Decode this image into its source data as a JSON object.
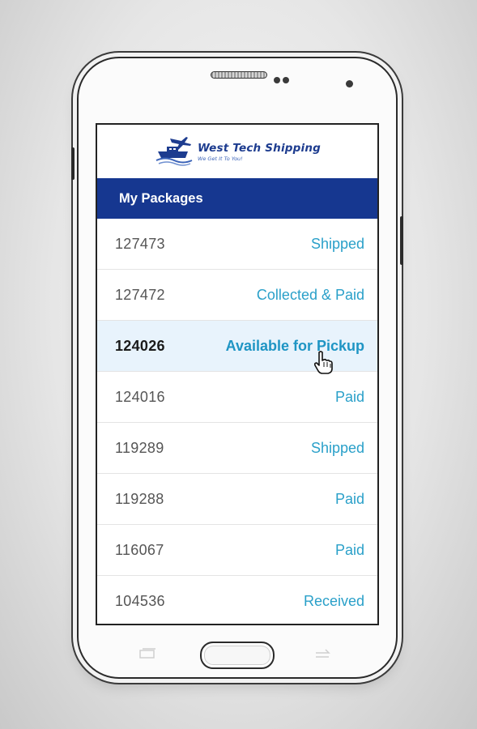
{
  "app": {
    "brand_name": "West Tech Shipping",
    "tagline": "We Get It To You!",
    "header_title": "My Packages"
  },
  "packages": [
    {
      "id": "127473",
      "status": "Shipped",
      "selected": false
    },
    {
      "id": "127472",
      "status": "Collected & Paid",
      "selected": false
    },
    {
      "id": "124026",
      "status": "Available for Pickup",
      "selected": true
    },
    {
      "id": "124016",
      "status": "Paid",
      "selected": false
    },
    {
      "id": "119289",
      "status": "Shipped",
      "selected": false
    },
    {
      "id": "119288",
      "status": "Paid",
      "selected": false
    },
    {
      "id": "116067",
      "status": "Paid",
      "selected": false
    },
    {
      "id": "104536",
      "status": "Received",
      "selected": false
    }
  ],
  "colors": {
    "header_bg": "#163790",
    "status_text": "#2aa0c9",
    "selected_row_bg": "#e8f3fc",
    "brand_text": "#1d3c8f"
  },
  "icons": {
    "logo": "ship-and-airplane-logo",
    "cursor": "hand-pointer-cursor",
    "recent_apps": "recent-apps-icon",
    "back": "back-icon"
  }
}
